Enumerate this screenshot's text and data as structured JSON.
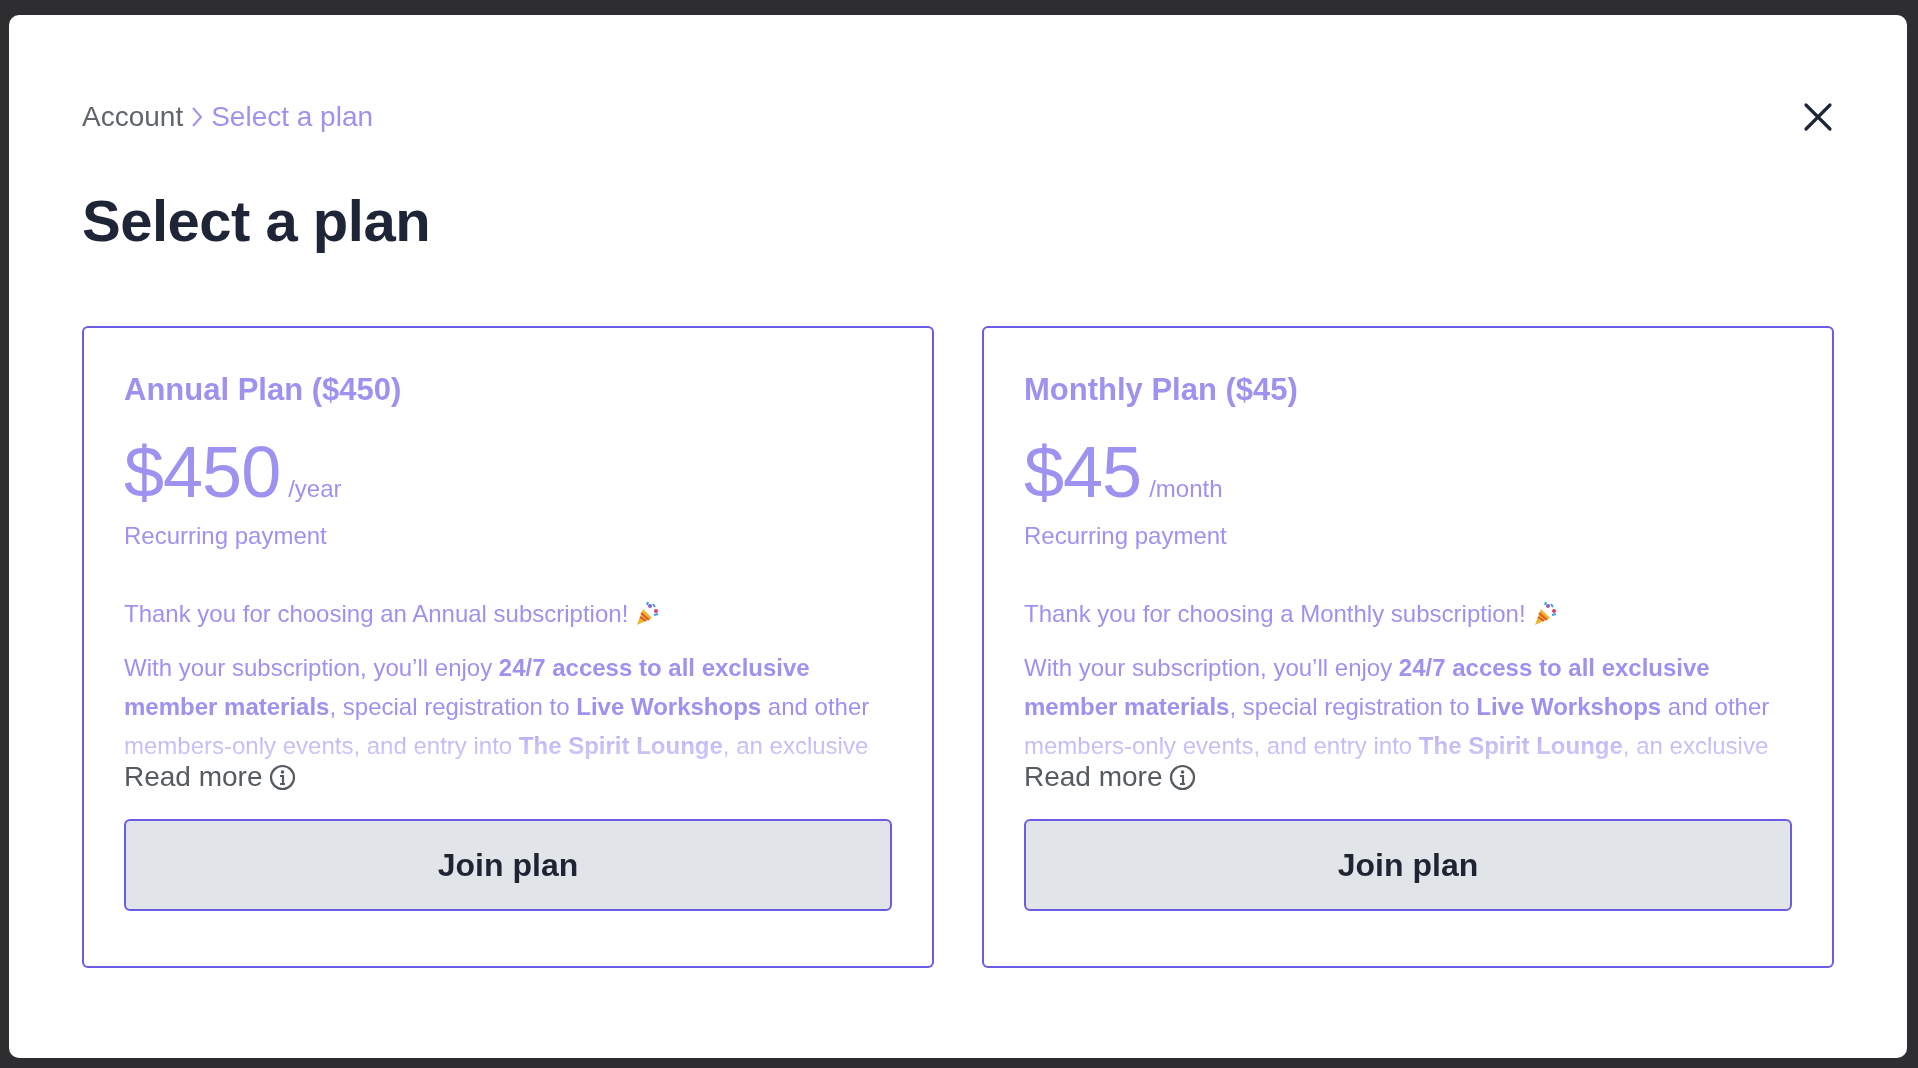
{
  "breadcrumb": [
    {
      "label": "Account",
      "current": false
    },
    {
      "label": "Select a plan",
      "current": true
    }
  ],
  "title": "Select a plan",
  "plans": [
    {
      "name": "Annual Plan ($450)",
      "price": "$450",
      "period": "/year",
      "billing": "Recurring payment",
      "thanks": "Thank you for choosing an Annual subscription!",
      "description": "With your subscription, you’ll enjoy **24/7 access to all exclusive member materials**, special registration to **Live Workshops** and other members-only events, and entry into **The Spirit Lounge**, an exclusive",
      "read_more": "Read more",
      "button": "Join plan"
    },
    {
      "name": "Monthly Plan ($45)",
      "price": "$45",
      "period": "/month",
      "billing": "Recurring payment",
      "thanks": "Thank you for choosing a Monthly subscription!",
      "description": "With your subscription, you’ll enjoy **24/7 access to all exclusive member materials**, special registration to **Live Workshops** and other members-only events, and entry into **The Spirit Lounge**, an exclusive",
      "read_more": "Read more",
      "button": "Join plan"
    }
  ]
}
